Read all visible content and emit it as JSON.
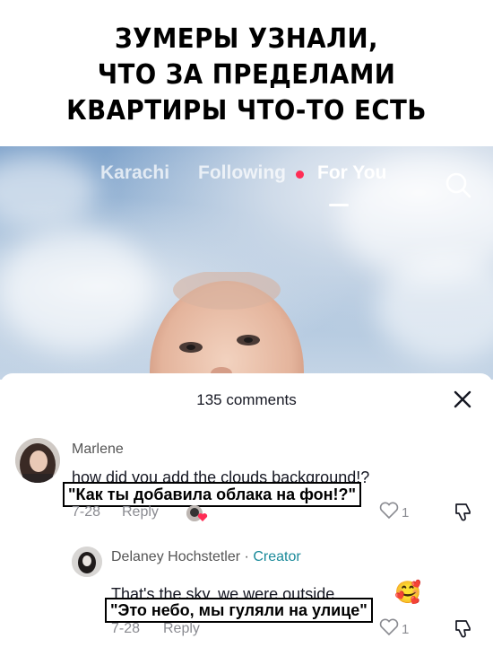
{
  "caption": {
    "line1": "ЗУМЕРЫ УЗНАЛИ,",
    "line2": "ЧТО ЗА ПРЕДЕЛАМИ",
    "line3": "КВАРТИРЫ ЧТО-ТО ЕСТЬ"
  },
  "nav": {
    "tabs": [
      "Karachi",
      "Following",
      "For You"
    ],
    "active_tab": "For You",
    "accent": "#ff2d55"
  },
  "comments_panel": {
    "count_label": "135 comments",
    "comments": [
      {
        "username": "Marlene",
        "text": "how did you add the clouds background!?",
        "translation_overlay": "\"Как ты добавила облака на фон!?\"",
        "date": "7-28",
        "reply_label": "Reply",
        "likes": "1"
      },
      {
        "username": "Delaney Hochstetler",
        "separator": "·",
        "badge": "Creator",
        "text": "That's the sky, we were outside",
        "emoji": "🥰",
        "translation_overlay": "\"Это небо, мы гуляли на улице\"",
        "date": "7-28",
        "reply_label": "Reply",
        "likes": "1"
      }
    ]
  }
}
